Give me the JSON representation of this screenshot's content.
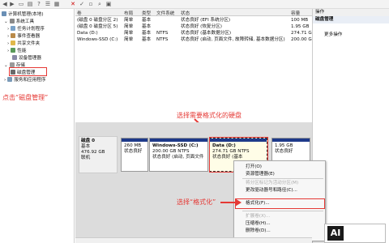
{
  "tree": {
    "root": "计算机管理(本地)",
    "items": [
      "系统工具",
      "任务计划程序",
      "事件查看器",
      "共享文件夹",
      "性能",
      "设备管理器",
      "存储",
      "磁盘管理",
      "服务和应用程序"
    ]
  },
  "table": {
    "headers": [
      "卷",
      "布局",
      "类型",
      "文件系统",
      "状态",
      "容量"
    ],
    "rows": [
      {
        "vol": "(磁盘 0 磁盘分区 2)",
        "layout": "简单",
        "type": "基本",
        "fs": "",
        "status": "状态良好 (EFI 系统分区)",
        "cap": "100 MB"
      },
      {
        "vol": "(磁盘 0 磁盘分区 5)",
        "layout": "简单",
        "type": "基本",
        "fs": "",
        "status": "状态良好 (恢复分区)",
        "cap": "1.95 GB"
      },
      {
        "vol": "Data (D:)",
        "layout": "简单",
        "type": "基本",
        "fs": "NTFS",
        "status": "状态良好 (基本数据分区)",
        "cap": "274.71 GB"
      },
      {
        "vol": "Windows-SSD (C:)",
        "layout": "简单",
        "type": "基本",
        "fs": "NTFS",
        "status": "状态良好 (启动, 页面文件, 故障转储, 基本数据分区)",
        "cap": "200.00 GB"
      }
    ]
  },
  "actions": {
    "head": "操作",
    "sub": "磁盘管理",
    "more": "更多操作"
  },
  "disk": {
    "name": "磁盘 0",
    "kind": "基本",
    "size": "476.92 GB",
    "state": "联机"
  },
  "partitions": [
    {
      "l1": "260 MB",
      "l2": "状态良好"
    },
    {
      "l1": "Windows-SSD (C:)",
      "l2": "200.00 GB NTFS",
      "l3": "状态良好 (启动, 页面文件"
    },
    {
      "l1": "Data (D:)",
      "l2": "274.71 GB NTFS",
      "l3": "状态良好 (基本"
    },
    {
      "l1": "1.95 GB",
      "l2": "状态良好"
    }
  ],
  "context_menu": {
    "items": [
      "打开(O)",
      "资源管理器(E)",
      "将分区标记为活动分区(M)",
      "更改驱动器号和路径(C)...",
      "格式化(F)...",
      "扩展卷(X)...",
      "压缩卷(H)...",
      "删除卷(D)..."
    ]
  },
  "annotations": {
    "click_disk": "点击“磁盘管理”",
    "select_disk": "选择需要格式化的硬盘",
    "select_format": "选择“格式化”"
  },
  "logo": {
    "letter": "AI"
  },
  "colors": {
    "annotation": "#e53935",
    "partition_bar": "#1e3a8a"
  }
}
